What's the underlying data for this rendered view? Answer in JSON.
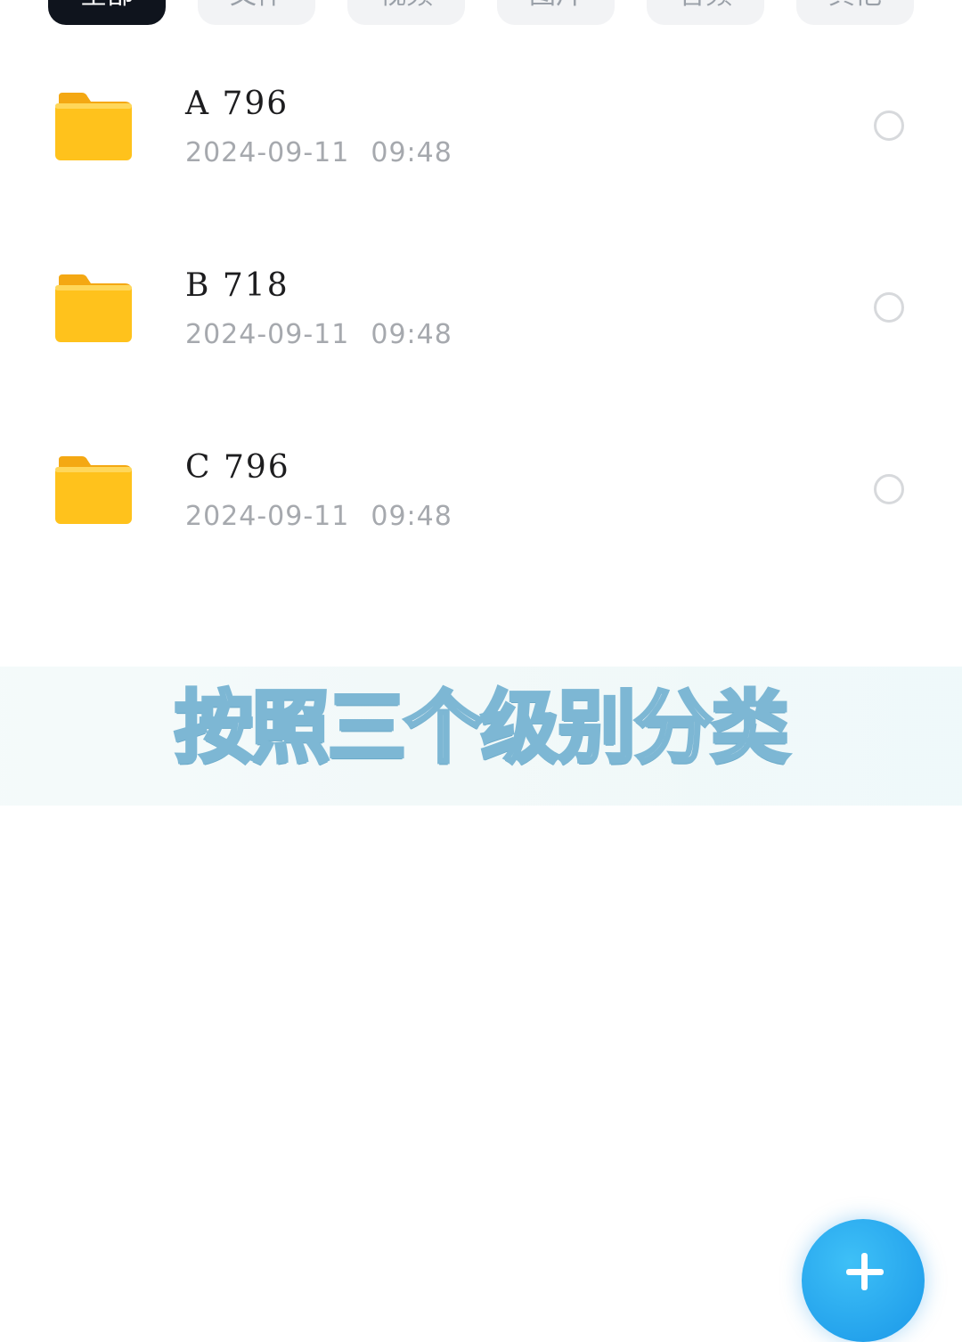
{
  "chips": [
    {
      "label": "全部",
      "active": true
    },
    {
      "label": "文件"
    },
    {
      "label": "视频"
    },
    {
      "label": "图片"
    },
    {
      "label": "音频"
    },
    {
      "label": "其他"
    }
  ],
  "folders": [
    {
      "name": "A 796",
      "date": "2024-09-11",
      "time": "09:48"
    },
    {
      "name": "B 718",
      "date": "2024-09-11",
      "time": "09:48"
    },
    {
      "name": "C 796",
      "date": "2024-09-11",
      "time": "09:48"
    }
  ],
  "caption": {
    "text": "按照三个级别分类"
  },
  "fab": {
    "icon": "plus-icon"
  },
  "colors": {
    "folder": "#ffc21c",
    "active_chip": "#0f141d",
    "fab": "#1a97e8",
    "caption_outline": "#7db7d4"
  }
}
